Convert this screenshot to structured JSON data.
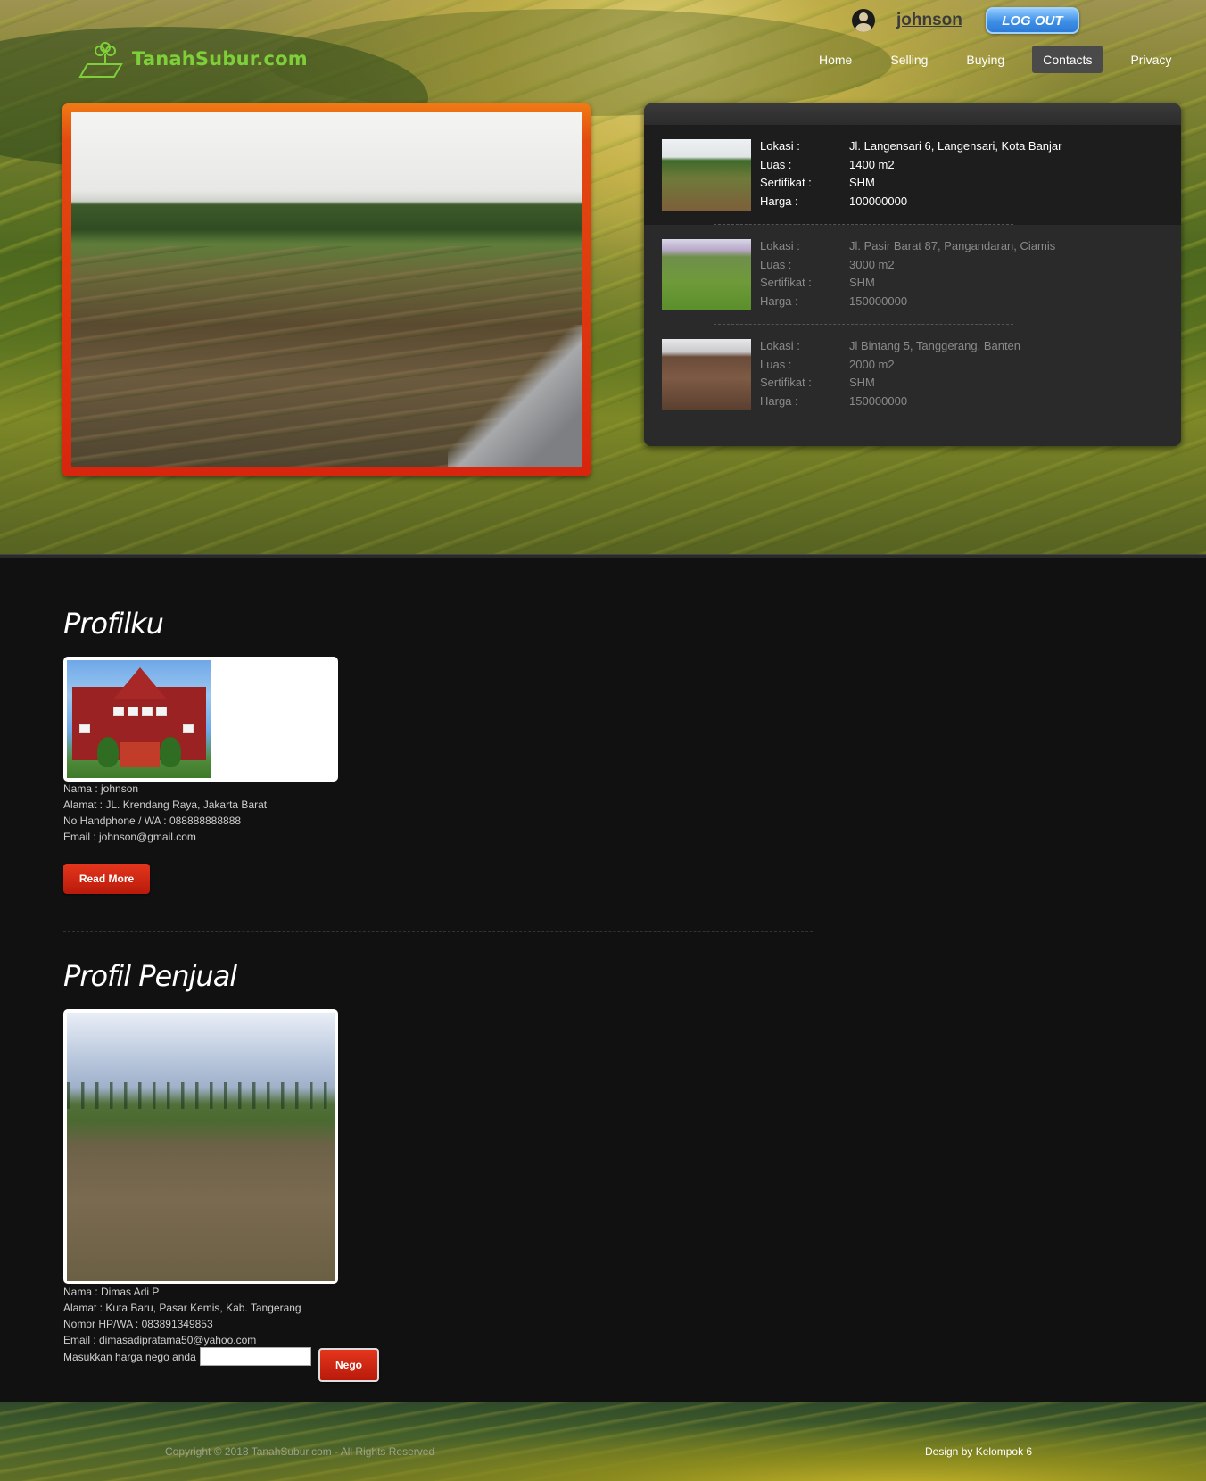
{
  "brand": {
    "name": "TanahSubur.com"
  },
  "user": {
    "name": "johnson",
    "logout_label": "LOG OUT"
  },
  "nav": [
    {
      "label": "Home",
      "active": false
    },
    {
      "label": "Selling",
      "active": false
    },
    {
      "label": "Buying",
      "active": false
    },
    {
      "label": "Contacts",
      "active": true
    },
    {
      "label": "Privacy",
      "active": false
    }
  ],
  "listings": [
    {
      "labels": {
        "lokasi": "Lokasi :",
        "luas": "Luas :",
        "sertifikat": "Sertifikat :",
        "harga": "Harga :"
      },
      "lokasi": "Jl. Langensari 6, Langensari, Kota Banjar",
      "luas": "1400 m2",
      "sertifikat": "SHM",
      "harga": "100000000"
    },
    {
      "labels": {
        "lokasi": "Lokasi :",
        "luas": "Luas :",
        "sertifikat": "Sertifikat :",
        "harga": "Harga :"
      },
      "lokasi": "Jl. Pasir Barat 87, Pangandaran, Ciamis",
      "luas": "3000 m2",
      "sertifikat": "SHM",
      "harga": "150000000"
    },
    {
      "labels": {
        "lokasi": "Lokasi :",
        "luas": "Luas :",
        "sertifikat": "Sertifikat :",
        "harga": "Harga :"
      },
      "lokasi": "Jl Bintang 5, Tanggerang, Banten",
      "luas": "2000 m2",
      "sertifikat": "SHM",
      "harga": "150000000"
    }
  ],
  "profilku": {
    "title": "Profilku",
    "nama": "Nama : johnson",
    "alamat": "Alamat : JL. Krendang Raya, Jakarta Barat",
    "phone": "No Handphone / WA : 088888888888",
    "email": "Email : johnson@gmail.com",
    "read_more": "Read More"
  },
  "penjual": {
    "title": "Profil Penjual",
    "nama": "Nama : Dimas Adi P",
    "alamat": "Alamat : Kuta Baru, Pasar Kemis, Kab. Tangerang",
    "phone": "Nomor HP/WA : 083891349853",
    "email": "Email : dimasadipratama50@yahoo.com",
    "nego_label": "Masukkan harga nego anda",
    "nego_value": "",
    "nego_button": "Nego"
  },
  "footer": {
    "copy_prefix": "Copyright © 2018 ",
    "copy_link": "TanahSubur.com",
    "copy_suffix": " - All Rights Reserved",
    "design_prefix": "Design by ",
    "design_link": "Kelompok 6"
  },
  "colors": {
    "brand_green": "#7fcf3b",
    "accent_red": "#d8250e",
    "logout_blue": "#3d8fe6",
    "background": "#111111"
  }
}
